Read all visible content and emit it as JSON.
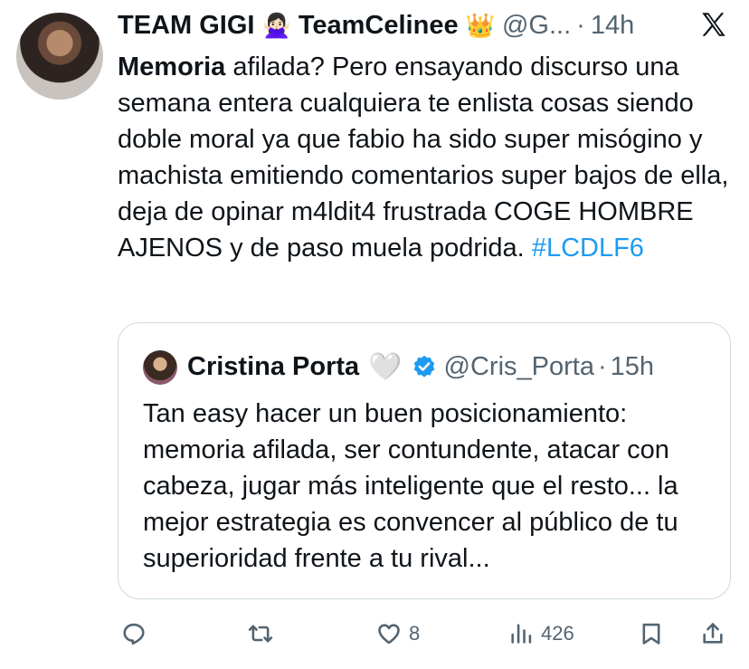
{
  "tweet": {
    "display_name": "TEAM GIGI",
    "emoji_1": "🙅🏻‍♀️",
    "display_name_2": "TeamCelinee",
    "emoji_2": "👑",
    "handle": "@G...",
    "separator": "·",
    "time": "14h",
    "text_bold": "Memoria",
    "text_body": " afilada? Pero ensayando discurso una semana entera cualquiera te enlista cosas siendo doble moral ya que fabio ha sido super misógino y machista emitiendo comentarios super bajos de ella, deja de opinar m4ldit4 frustrada COGE HOMBRE AJENOS y de paso muela podrida. ",
    "hashtag": "#LCDLF6"
  },
  "quote": {
    "display_name": "Cristina Porta",
    "emoji": "🤍",
    "handle": "@Cris_Porta",
    "separator": "·",
    "time": "15h",
    "text": "Tan easy hacer un buen posicionamiento: memoria afilada, ser contundente, atacar con cabeza, jugar más inteligente que el resto... la mejor estrategia es convencer al público de tu superioridad frente a tu rival..."
  },
  "actions": {
    "likes": "8",
    "views": "426"
  },
  "colors": {
    "text": "#0f1419",
    "secondary": "#536471",
    "link": "#1d9bf0",
    "border": "#cfd9de"
  }
}
